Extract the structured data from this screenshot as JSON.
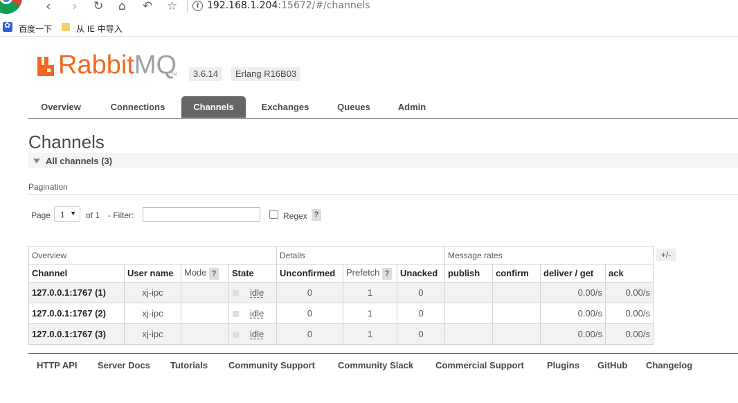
{
  "browser": {
    "url_host": "192.168.1.204",
    "url_rest": ":15672/#/channels",
    "bookmarks": [
      "百度一下",
      "从 IE 中导入"
    ]
  },
  "header": {
    "logo_rabbit": "Rabbit",
    "logo_mq": "MQ",
    "logo_tm": "TM",
    "version": "3.6.14",
    "erlang": "Erlang R16B03"
  },
  "tabs": [
    "Overview",
    "Connections",
    "Channels",
    "Exchanges",
    "Queues",
    "Admin"
  ],
  "main": {
    "title": "Channels",
    "section_title": "All channels (3)",
    "pagination_label": "Pagination",
    "page_label": "Page",
    "page_value": "1",
    "of_label": "of 1",
    "filter_label": "- Filter:",
    "regex_label": "Regex",
    "help": "?",
    "plusminus": "+/-"
  },
  "table": {
    "groups": [
      "Overview",
      "Details",
      "Message rates"
    ],
    "columns": [
      "Channel",
      "User name",
      "Mode",
      "State",
      "Unconfirmed",
      "Prefetch",
      "Unacked",
      "publish",
      "confirm",
      "deliver / get",
      "ack"
    ],
    "rows": [
      {
        "channel": "127.0.0.1:1767 (1)",
        "user": "xj-ipc",
        "mode": "",
        "state": "idle",
        "unconfirmed": "0",
        "prefetch": "1",
        "unacked": "0",
        "publish": "",
        "confirm": "",
        "deliver": "0.00/s",
        "ack": "0.00/s"
      },
      {
        "channel": "127.0.0.1:1767 (2)",
        "user": "xj-ipc",
        "mode": "",
        "state": "idle",
        "unconfirmed": "0",
        "prefetch": "1",
        "unacked": "0",
        "publish": "",
        "confirm": "",
        "deliver": "0.00/s",
        "ack": "0.00/s"
      },
      {
        "channel": "127.0.0.1:1767 (3)",
        "user": "xj-ipc",
        "mode": "",
        "state": "idle",
        "unconfirmed": "0",
        "prefetch": "1",
        "unacked": "0",
        "publish": "",
        "confirm": "",
        "deliver": "0.00/s",
        "ack": "0.00/s"
      }
    ]
  },
  "footer": [
    "HTTP API",
    "Server Docs",
    "Tutorials",
    "Community Support",
    "Community Slack",
    "Commercial Support",
    "Plugins",
    "GitHub",
    "Changelog"
  ]
}
